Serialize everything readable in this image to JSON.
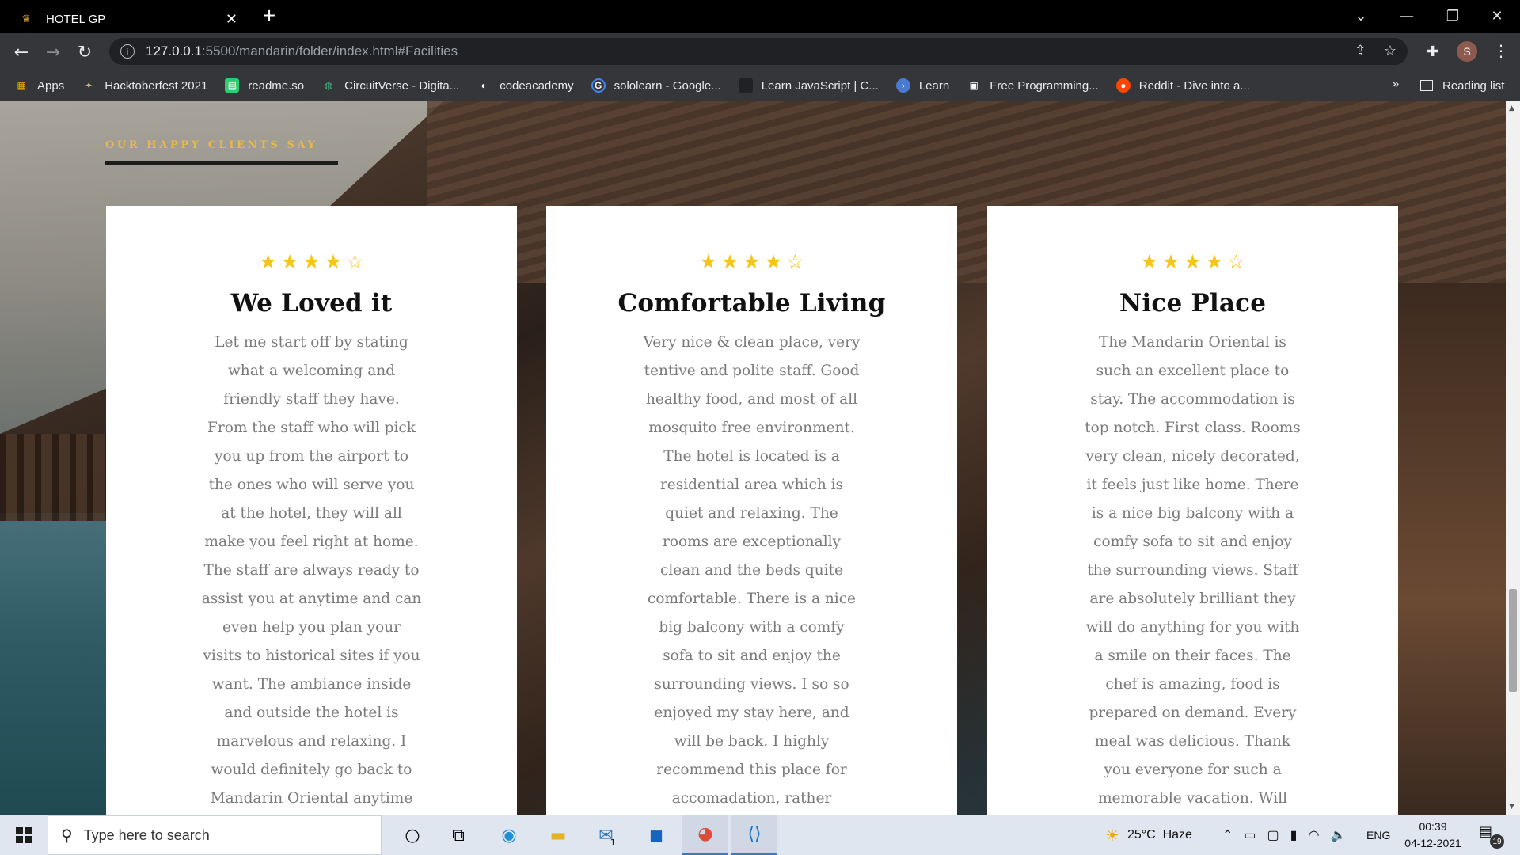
{
  "browser": {
    "tab_title": "HOTEL GP",
    "url_host": "127.0.0.1",
    "url_rest": ":5500/mandarin/folder/index.html#Facilities",
    "profile_initial": "S",
    "bookmarks": [
      {
        "label": "Apps",
        "icon": "apps-grid-icon",
        "color": "#f4b400"
      },
      {
        "label": "Hacktoberfest 2021",
        "icon": "hacktoberfest-icon",
        "color": "#c9b48a"
      },
      {
        "label": "readme.so",
        "icon": "readme-icon",
        "color": "#2ecc71"
      },
      {
        "label": "CircuitVerse - Digita...",
        "icon": "circuitverse-icon",
        "color": "#42b983"
      },
      {
        "label": "codeacademy",
        "icon": "codecademy-icon",
        "color": "#ffffff"
      },
      {
        "label": "sololearn - Google...",
        "icon": "google-icon",
        "color": "#4285f4"
      },
      {
        "label": "Learn JavaScript | C...",
        "icon": "blank-page-icon",
        "color": "#202124"
      },
      {
        "label": "Learn",
        "icon": "learn-arrow-icon",
        "color": "#4a7bd0"
      },
      {
        "label": "Free Programming...",
        "icon": "programming-icon",
        "color": "#ffffff"
      },
      {
        "label": "Reddit - Dive into a...",
        "icon": "reddit-icon",
        "color": "#ff4500"
      }
    ],
    "reading_list": "Reading list"
  },
  "page": {
    "section_label": "OUR HAPPY CLIENTS SAY",
    "accent_color": "#e8b84a",
    "reviews": [
      {
        "rating": 4,
        "max_rating": 5,
        "title": "We Loved it",
        "text": "Let me start off by stating what a welcoming and friendly staff they have. From the staff who will pick you up from the airport to the ones who will serve you at the hotel, they will all make you feel right at home. The staff are always ready to assist you at anytime and can even help you plan your visits to historical sites if you want. The ambiance inside and outside the hotel is marvelous and relaxing. I would definitely go back to Mandarin Oriental anytime"
      },
      {
        "rating": 4,
        "max_rating": 5,
        "title": "Comfortable Living",
        "text": "Very nice & clean place, very tentive and polite staff. Good healthy food, and most of all mosquito free environment. The hotel is located is a residential area which is quiet and relaxing. The rooms are exceptionally clean and the beds quite comfortable. There is a nice big balcony with a comfy sofa to sit and enjoy the surrounding views. I so so enjoyed my stay here, and will be back. I highly recommend this place for accomadation, rather"
      },
      {
        "rating": 4,
        "max_rating": 5,
        "title": "Nice Place",
        "text": "The Mandarin Oriental is such an excellent place to stay. The accommodation is top notch. First class. Rooms very clean, nicely decorated, it feels just like home. There is a nice big balcony with a comfy sofa to sit and enjoy the surrounding views. Staff are absolutely brilliant they will do anything for you with a smile on their faces. The chef is amazing, food is prepared on demand. Every meal was delicious. Thank you everyone for such a memorable vacation. Will"
      }
    ]
  },
  "taskbar": {
    "search_placeholder": "Type here to search",
    "weather": "25°C  Haze",
    "language": "ENG",
    "time": "00:39",
    "date": "04-12-2021",
    "notification_count": "19",
    "mail_badge": "1"
  }
}
